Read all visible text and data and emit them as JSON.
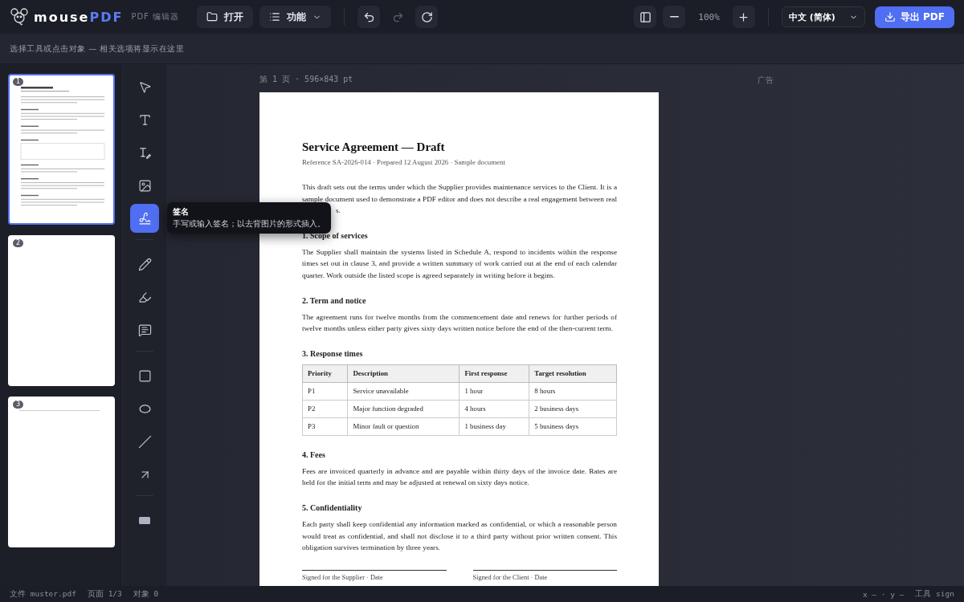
{
  "app": {
    "logo_main": "mouse",
    "logo_accent": "PDF",
    "subtitle": "PDF 编辑器"
  },
  "toolbar": {
    "open": "打开",
    "features": "功能",
    "history": [
      {
        "kind": "undo",
        "disabled": false
      },
      {
        "kind": "redo",
        "disabled": true
      },
      {
        "kind": "reload",
        "disabled": false
      }
    ],
    "zoom": "100%",
    "language": "中文 (简体)",
    "export": "导出 PDF"
  },
  "hint": "选择工具或点击对象 — 相关选项将显示在这里",
  "thumbnails": [
    {
      "number": "1",
      "selected": true,
      "kind": "full"
    },
    {
      "number": "2",
      "selected": false,
      "kind": "blank"
    },
    {
      "number": "3",
      "selected": false,
      "kind": "line"
    }
  ],
  "tool_groups": [
    {
      "tools": [
        {
          "kind": "select",
          "selected": false
        },
        {
          "kind": "text",
          "selected": false
        },
        {
          "kind": "edittext",
          "selected": false
        },
        {
          "kind": "image",
          "selected": false
        },
        {
          "kind": "signature",
          "selected": true,
          "tooltip": {
            "title": "签名",
            "text": "手写或输入签名；以去背图片的形式插入。"
          }
        }
      ]
    },
    {
      "tools": [
        {
          "kind": "pencil",
          "selected": false
        },
        {
          "kind": "highlight",
          "selected": false
        },
        {
          "kind": "comment",
          "selected": false
        }
      ]
    },
    {
      "tools": [
        {
          "kind": "rect",
          "selected": false
        },
        {
          "kind": "ellipse",
          "selected": false
        },
        {
          "kind": "line",
          "selected": false
        },
        {
          "kind": "arrow",
          "selected": false
        }
      ]
    },
    {
      "tools": [
        {
          "kind": "redact",
          "selected": false
        }
      ]
    }
  ],
  "page_label": "第 1 页 · 596×843 pt",
  "ad_label": "广告",
  "document": {
    "title": "Service Agreement — Draft",
    "meta": "Reference SA-2026-014 · Prepared 12 August 2026 · Sample document",
    "intro": "This draft sets out the terms under which the Supplier provides maintenance services to the Client. It is a sample document used to demonstrate a PDF editor and does not describe a real engagement between real",
    "intro_tail": "s.",
    "sections": [
      {
        "heading": "1. Scope of services",
        "text": "The Supplier shall maintain the systems listed in Schedule A, respond to incidents within the response times set out in clause 3, and provide a written summary of work carried out at the end of each calendar quarter. Work outside the listed scope is agreed separately in writing before it begins."
      },
      {
        "heading": "2. Term and notice",
        "text": "The agreement runs for twelve months from the commencement date and renews for further periods of twelve months unless either party gives sixty days written notice before the end of the then-current term."
      },
      {
        "heading": "3. Response times",
        "table": {
          "columns": [
            "Priority",
            "Description",
            "First response",
            "Target resolution"
          ],
          "rows": [
            [
              "P1",
              "Service unavailable",
              "1 hour",
              "8 hours"
            ],
            [
              "P2",
              "Major function degraded",
              "4 hours",
              "2 business days"
            ],
            [
              "P3",
              "Minor fault or question",
              "1 business day",
              "5 business days"
            ]
          ]
        }
      },
      {
        "heading": "4. Fees",
        "text": "Fees are invoiced quarterly in advance and are payable within thirty days of the invoice date. Rates are held for the initial term and may be adjusted at renewal on sixty days notice."
      },
      {
        "heading": "5. Confidentiality",
        "text": "Each party shall keep confidential any information marked as confidential, or which a reasonable person would treat as confidential, and shall not disclose it to a third party without prior written consent. This obligation survives termination by three years."
      }
    ],
    "signatures": [
      "Signed for the Supplier · Date",
      "Signed for the Client · Date"
    ]
  },
  "status_bar": {
    "left": [
      "文件 muster.pdf",
      "页面 1/3",
      "对象 0"
    ],
    "right": [
      "x – · y –",
      "工具 sign"
    ]
  }
}
